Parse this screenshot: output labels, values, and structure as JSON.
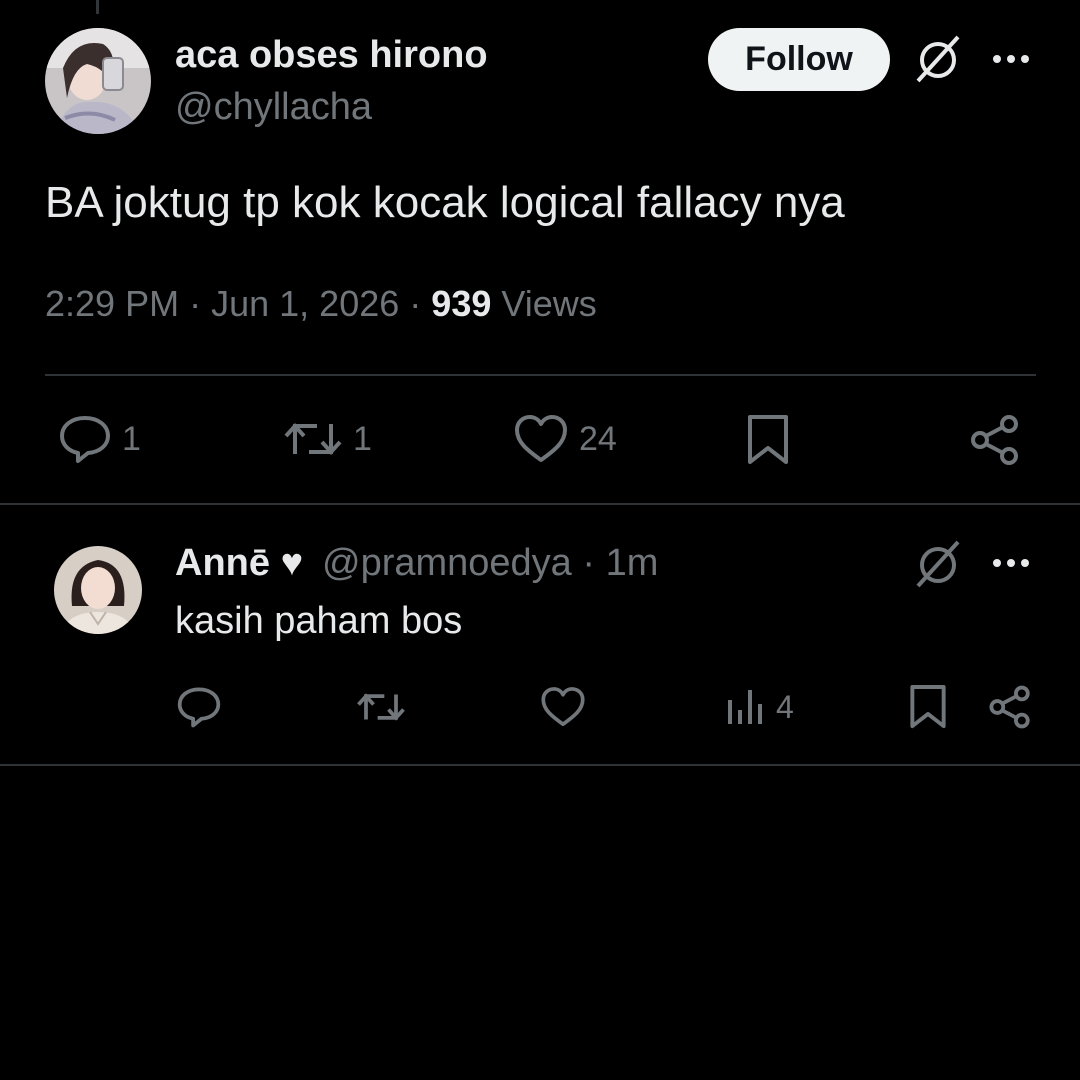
{
  "post": {
    "author": {
      "display_name": "aca obses hirono",
      "handle": "@chyllacha",
      "avatar_icon": "avatar-photo"
    },
    "follow_label": "Follow",
    "text": "BA joktug tp kok kocak logical fallacy nya",
    "time": "2:29 PM",
    "date": "Jun 1, 2026",
    "views_count": "939",
    "views_label": "Views",
    "separator": "·",
    "stats": {
      "replies": "1",
      "reposts": "1",
      "likes": "24"
    },
    "icons": [
      "grok-icon",
      "more-icon",
      "reply-icon",
      "repost-icon",
      "like-icon",
      "bookmark-icon",
      "share-icon"
    ]
  },
  "reply": {
    "display_name": "Annē",
    "heart": "♥",
    "handle": "@pramnoedya",
    "time": "· 1m",
    "text": "kasih paham bos",
    "views": "4",
    "icons": [
      "grok-icon",
      "more-icon",
      "reply-icon",
      "repost-icon",
      "like-icon",
      "views-icon",
      "bookmark-icon",
      "share-icon"
    ]
  },
  "colors": {
    "background": "#000000",
    "text_primary": "#e7e9ea",
    "text_secondary": "#71767b",
    "divider": "#2f3336",
    "follow_bg": "#eff3f4"
  }
}
